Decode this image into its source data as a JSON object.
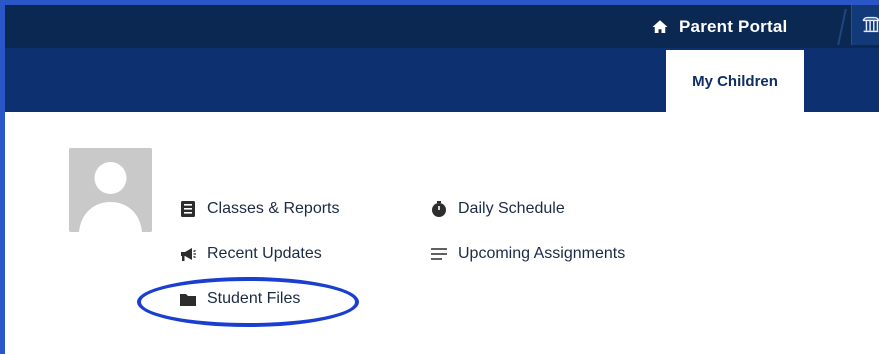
{
  "header": {
    "portal_label": "Parent Portal",
    "home_icon": "home-icon",
    "extra_tab_icon": "pillar-icon"
  },
  "tabs": [
    {
      "label": "My Children",
      "active": true
    }
  ],
  "links": {
    "classes_reports": {
      "label": "Classes & Reports",
      "icon": "report-icon"
    },
    "recent_updates": {
      "label": "Recent Updates",
      "icon": "megaphone-icon"
    },
    "student_files": {
      "label": "Student Files",
      "icon": "folder-icon",
      "highlighted": true
    },
    "daily_schedule": {
      "label": "Daily Schedule",
      "icon": "stopwatch-icon"
    },
    "upcoming_assignments": {
      "label": "Upcoming Assignments",
      "icon": "list-icon"
    }
  },
  "colors": {
    "frame": "#2a56c8",
    "topbar": "#0a2852",
    "navband": "#0d3170",
    "highlight": "#1a3fd0"
  }
}
